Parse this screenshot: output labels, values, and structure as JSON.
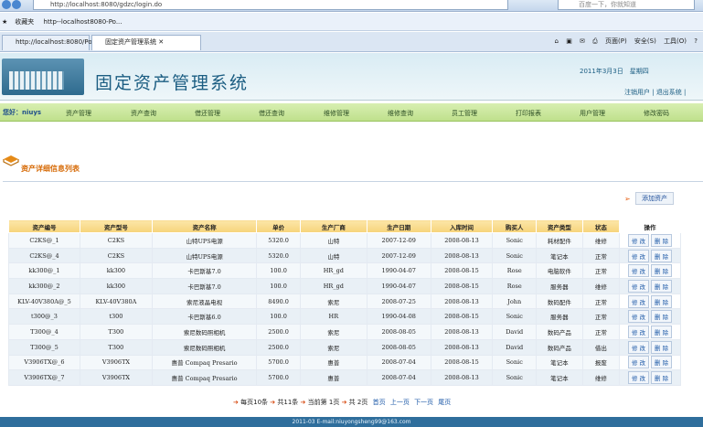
{
  "browser": {
    "url": "http://localhost:8080/gdzc/login.do",
    "search_placeholder": "百度一下，你就知道",
    "favorites_label": "收藏夹",
    "fav_link": "http--localhost8080-Po...",
    "tabs": [
      "http://localhost:8080/Po...",
      "固定资产管理系统"
    ],
    "tools": [
      "页面(P)",
      "安全(S)",
      "工具(O)"
    ]
  },
  "header": {
    "title": "固定资产管理系统",
    "date": "2011年3月3日　星期四",
    "logout_links": [
      "注销用户",
      "退出系统"
    ]
  },
  "menu": {
    "user": "您好：niuys",
    "items": [
      "资产管理",
      "资产查询",
      "借还管理",
      "借还查询",
      "维修管理",
      "维修查询",
      "员工管理",
      "打印报表",
      "用户管理",
      "修改密码"
    ]
  },
  "section_title": "资产详细信息列表",
  "add_button": "添加资产",
  "table": {
    "headers": [
      "资产编号",
      "资产型号",
      "资产名称",
      "单价",
      "生产厂商",
      "生产日期",
      "入库时间",
      "购买人",
      "资产类型",
      "状态",
      "操作"
    ],
    "edit_label": "修 改",
    "delete_label": "删 除",
    "rows": [
      [
        "C2KS@_1",
        "C2KS",
        "山特UPS电源",
        "5320.0",
        "山特",
        "2007-12-09",
        "2008-08-13",
        "Sonic",
        "耗材配件",
        "维修"
      ],
      [
        "C2KS@_4",
        "C2KS",
        "山特UPS电源",
        "5320.0",
        "山特",
        "2007-12-09",
        "2008-08-13",
        "Sonic",
        "笔记本",
        "正常"
      ],
      [
        "kk300@_1",
        "kk300",
        "卡巴斯基7.0",
        "100.0",
        "HR_gd",
        "1990-04-07",
        "2008-08-15",
        "Rose",
        "电脑软件",
        "正常"
      ],
      [
        "kk300@_2",
        "kk300",
        "卡巴斯基7.0",
        "100.0",
        "HR_gd",
        "1990-04-07",
        "2008-08-15",
        "Rose",
        "服务器",
        "维修"
      ],
      [
        "KLV-40V380A@_5",
        "KLV-40V380A",
        "索尼液晶电视",
        "8490.0",
        "索尼",
        "2008-07-25",
        "2008-08-13",
        "John",
        "数码配件",
        "正常"
      ],
      [
        "t300@_3",
        "t300",
        "卡巴斯基6.0",
        "100.0",
        "HR",
        "1990-04-08",
        "2008-08-15",
        "Sonic",
        "服务器",
        "正常"
      ],
      [
        "T300@_4",
        "T300",
        "索尼数码照相机",
        "2500.0",
        "索尼",
        "2008-08-05",
        "2008-08-13",
        "David",
        "数码产品",
        "正常"
      ],
      [
        "T300@_5",
        "T300",
        "索尼数码照相机",
        "2500.0",
        "索尼",
        "2008-08-05",
        "2008-08-13",
        "David",
        "数码产品",
        "借出"
      ],
      [
        "V3906TX@_6",
        "V3906TX",
        "惠普 Compaq Presario",
        "5700.0",
        "惠普",
        "2008-07-04",
        "2008-08-15",
        "Sonic",
        "笔记本",
        "报废"
      ],
      [
        "V3906TX@_7",
        "V3906TX",
        "惠普 Compaq Presario",
        "5700.0",
        "惠普",
        "2008-07-04",
        "2008-08-13",
        "Sonic",
        "笔记本",
        "维修"
      ]
    ]
  },
  "pager": {
    "per_page": "每页10条",
    "total": "共11条",
    "current": "当前第 1页",
    "pages": "共 2页",
    "links": [
      "首页",
      "上一页",
      "下一页",
      "尾页"
    ]
  },
  "footer": "2011-03 E-mail:niuyongsheng99@163.com"
}
